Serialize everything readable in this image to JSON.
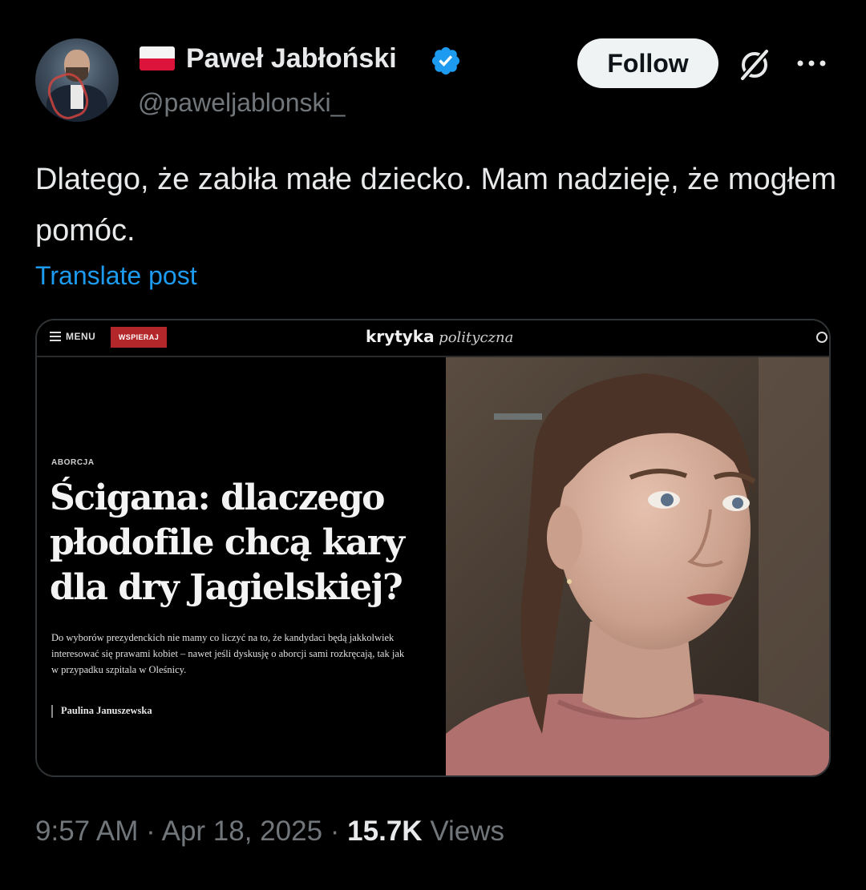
{
  "author": {
    "name": "Paweł Jabłoński",
    "handle": "@paweljablonski_",
    "verified": true,
    "flag": "poland-flag"
  },
  "actions": {
    "follow_label": "Follow",
    "grok_icon": "grok-icon",
    "more_icon": "more-icon"
  },
  "post": {
    "text": "Dlatego, że zabiła małe dziecko. Mam nadzieję, że mogłem pomóc.",
    "translate_label": "Translate post"
  },
  "media": {
    "site": {
      "menu_label": "MENU",
      "support_label": "WSPIERAJ",
      "logo_bold": "krytyka",
      "logo_light": "polityczna"
    },
    "article": {
      "category": "ABORCJA",
      "headline": "Ścigana: dlaczego płodofile chcą kary dla dry Jagielskiej?",
      "lead": "Do wyborów prezydenckich nie mamy co liczyć na to, że kandydaci będą jakkolwiek interesować się prawami kobiet – nawet jeśli dyskusję o aborcji sami rozkręcają, tak jak w przypadku szpitala w Oleśnicy.",
      "author": "Paulina Januszewska"
    }
  },
  "meta": {
    "time": "9:57 AM",
    "separator": "·",
    "date": "Apr 18, 2025",
    "views_count": "15.7K",
    "views_label": "Views"
  },
  "colors": {
    "background": "#000000",
    "text": "#e7e9ea",
    "muted": "#71767b",
    "link": "#1d9bf0",
    "verified": "#1d9bf0",
    "support_button": "#b3272a"
  }
}
